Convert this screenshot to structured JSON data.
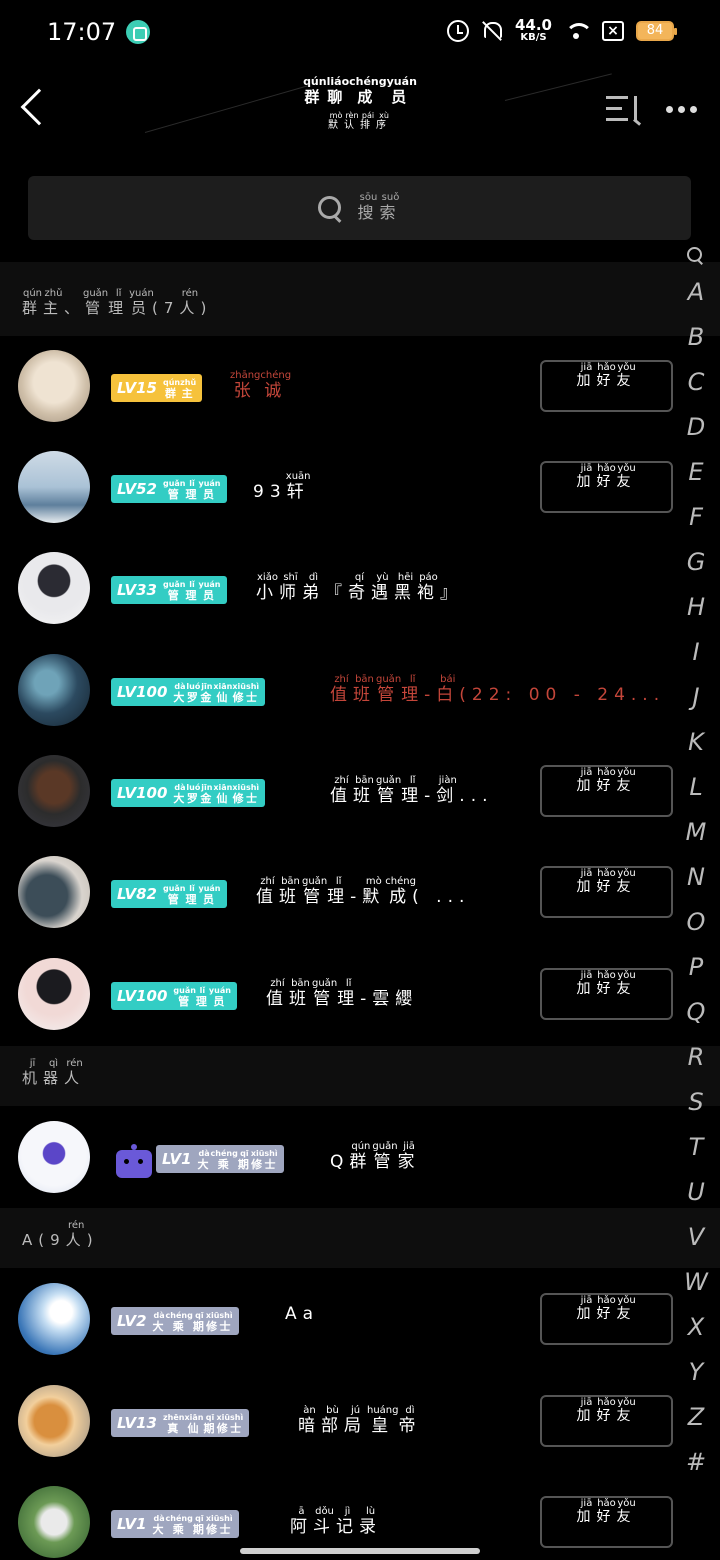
{
  "status_bar": {
    "time": "17:07",
    "net_speed_value": "44.0",
    "net_speed_unit": "KB/S",
    "battery": "84",
    "icons": [
      "app-icon",
      "alarm-icon",
      "mute-icon",
      "wifi-icon",
      "sim-x-icon",
      "battery-icon"
    ]
  },
  "header": {
    "title": [
      [
        "群",
        "qún"
      ],
      [
        "聊",
        "liáo"
      ],
      [
        "成",
        "chéng"
      ],
      [
        "员",
        "yuán"
      ]
    ],
    "subtitle": [
      [
        "默",
        "mò"
      ],
      [
        "认",
        "rèn"
      ],
      [
        "排",
        "pái"
      ],
      [
        "序",
        "xù"
      ]
    ],
    "icons": [
      "back-icon",
      "sort-icon",
      "more-icon"
    ]
  },
  "search": {
    "placeholder": [
      [
        "搜",
        "sōu"
      ],
      [
        "索",
        "suǒ"
      ]
    ]
  },
  "sections": [
    {
      "id": "admins",
      "label": [
        [
          "群",
          "qún"
        ],
        [
          "主",
          "zhǔ"
        ],
        [
          "、",
          ""
        ],
        [
          "管",
          "guǎn"
        ],
        [
          "理",
          "lǐ"
        ],
        [
          "员",
          "yuán"
        ],
        [
          "(7",
          ""
        ],
        [
          "人",
          "rén"
        ],
        [
          ")",
          ""
        ]
      ]
    },
    {
      "id": "robots",
      "label": [
        [
          "机",
          "jī"
        ],
        [
          "器",
          "qì"
        ],
        [
          "人",
          "rén"
        ]
      ]
    },
    {
      "id": "a",
      "label": [
        [
          "A(9",
          ""
        ],
        [
          "人",
          "rén"
        ],
        [
          ")",
          ""
        ]
      ]
    }
  ],
  "add_friend_label": [
    [
      "加",
      "jiā"
    ],
    [
      "好",
      "hǎo"
    ],
    [
      "友",
      "yǒu"
    ]
  ],
  "members": [
    {
      "section": "admins",
      "level": "LV15",
      "badge_type": "owner",
      "title": [
        [
          "群",
          "qún"
        ],
        [
          "主",
          "zhǔ"
        ]
      ],
      "name": [
        [
          "张",
          "zhāng"
        ],
        [
          "诚",
          "chéng"
        ]
      ],
      "name_color": "red",
      "add_button": true
    },
    {
      "section": "admins",
      "level": "LV52",
      "badge_type": "admin",
      "title": [
        [
          "管",
          "guǎn"
        ],
        [
          "理",
          "lǐ"
        ],
        [
          "员",
          "yuán"
        ]
      ],
      "name": [
        [
          "93",
          ""
        ],
        [
          "轩",
          "xuān"
        ]
      ],
      "add_button": true
    },
    {
      "section": "admins",
      "level": "LV33",
      "badge_type": "admin",
      "title": [
        [
          "管",
          "guǎn"
        ],
        [
          "理",
          "lǐ"
        ],
        [
          "员",
          "yuán"
        ]
      ],
      "name": [
        [
          "小",
          "xiǎo"
        ],
        [
          "师",
          "shī"
        ],
        [
          "弟",
          "dì"
        ],
        [
          "『",
          ""
        ],
        [
          "奇",
          "qí"
        ],
        [
          "遇",
          "yù"
        ],
        [
          "黑",
          "hēi"
        ],
        [
          "袍",
          "páo"
        ],
        [
          "』",
          ""
        ]
      ],
      "add_button": false
    },
    {
      "section": "admins",
      "level": "LV100",
      "badge_type": "admin",
      "title": [
        [
          "大",
          "dà"
        ],
        [
          "罗",
          "luó"
        ],
        [
          "金",
          "jīn"
        ],
        [
          "仙",
          "xiān"
        ],
        [
          "修",
          "xiū"
        ],
        [
          "士",
          "shì"
        ]
      ],
      "name": [
        [
          "值",
          "zhí"
        ],
        [
          "班",
          "bān"
        ],
        [
          "管",
          "guǎn"
        ],
        [
          "理",
          "lǐ"
        ],
        [
          "-",
          ""
        ],
        [
          "白",
          "bái"
        ],
        [
          "(22: 00 - 24...",
          ""
        ]
      ],
      "name_color": "red",
      "add_button": false
    },
    {
      "section": "admins",
      "level": "LV100",
      "badge_type": "admin",
      "title": [
        [
          "大",
          "dà"
        ],
        [
          "罗",
          "luó"
        ],
        [
          "金",
          "jīn"
        ],
        [
          "仙",
          "xiān"
        ],
        [
          "修",
          "xiū"
        ],
        [
          "士",
          "shì"
        ]
      ],
      "name": [
        [
          "值",
          "zhí"
        ],
        [
          "班",
          "bān"
        ],
        [
          "管",
          "guǎn"
        ],
        [
          "理",
          "lǐ"
        ],
        [
          "-",
          ""
        ],
        [
          "剑",
          "jiàn"
        ],
        [
          "...",
          ""
        ]
      ],
      "add_button": true
    },
    {
      "section": "admins",
      "level": "LV82",
      "badge_type": "admin",
      "title": [
        [
          "管",
          "guǎn"
        ],
        [
          "理",
          "lǐ"
        ],
        [
          "员",
          "yuán"
        ]
      ],
      "name": [
        [
          "值",
          "zhí"
        ],
        [
          "班",
          "bān"
        ],
        [
          "管",
          "guǎn"
        ],
        [
          "理",
          "lǐ"
        ],
        [
          "-",
          ""
        ],
        [
          "默",
          "mò"
        ],
        [
          "成",
          "chéng"
        ],
        [
          "( ...",
          ""
        ]
      ],
      "add_button": true
    },
    {
      "section": "admins",
      "level": "LV100",
      "badge_type": "admin",
      "title": [
        [
          "管",
          "guǎn"
        ],
        [
          "理",
          "lǐ"
        ],
        [
          "员",
          "yuán"
        ]
      ],
      "name": [
        [
          "值",
          "zhí"
        ],
        [
          "班",
          "bān"
        ],
        [
          "管",
          "guǎn"
        ],
        [
          "理",
          "lǐ"
        ],
        [
          "-雲纓",
          ""
        ]
      ],
      "add_button": true
    },
    {
      "section": "robots",
      "level": "LV1",
      "badge_type": "rank",
      "title": [
        [
          "大",
          "dà"
        ],
        [
          "乘",
          "chéng"
        ],
        [
          "期",
          "qī"
        ],
        [
          "修",
          "xiū"
        ],
        [
          "士",
          "shì"
        ]
      ],
      "name": [
        [
          "Q",
          ""
        ],
        [
          "群",
          "qún"
        ],
        [
          "管",
          "guǎn"
        ],
        [
          "家",
          "jiā"
        ]
      ],
      "add_button": false,
      "robot_icon": true
    },
    {
      "section": "a",
      "level": "LV2",
      "badge_type": "rank",
      "title": [
        [
          "大",
          "dà"
        ],
        [
          "乘",
          "chéng"
        ],
        [
          "期",
          "qī"
        ],
        [
          "修",
          "xiū"
        ],
        [
          "士",
          "shì"
        ]
      ],
      "name": [
        [
          "Aa",
          ""
        ]
      ],
      "add_button": true
    },
    {
      "section": "a",
      "level": "LV13",
      "badge_type": "rank",
      "title": [
        [
          "真",
          "zhēn"
        ],
        [
          "仙",
          "xiān"
        ],
        [
          "期",
          "qī"
        ],
        [
          "修",
          "xiū"
        ],
        [
          "士",
          "shì"
        ]
      ],
      "name": [
        [
          "暗",
          "àn"
        ],
        [
          "部",
          "bù"
        ],
        [
          "局",
          "jú"
        ],
        [
          "皇",
          "huáng"
        ],
        [
          "帝",
          "dì"
        ]
      ],
      "add_button": true
    },
    {
      "section": "a",
      "level": "LV1",
      "badge_type": "rank",
      "title": [
        [
          "大",
          "dà"
        ],
        [
          "乘",
          "chéng"
        ],
        [
          "期",
          "qī"
        ],
        [
          "修",
          "xiū"
        ],
        [
          "士",
          "shì"
        ]
      ],
      "name": [
        [
          "阿",
          "ā"
        ],
        [
          "斗",
          "dǒu"
        ],
        [
          "记",
          "jì"
        ],
        [
          "录",
          "lù"
        ]
      ],
      "add_button": true
    }
  ],
  "index_letters": [
    "A",
    "B",
    "C",
    "D",
    "E",
    "F",
    "G",
    "H",
    "I",
    "J",
    "K",
    "L",
    "M",
    "N",
    "O",
    "P",
    "Q",
    "R",
    "S",
    "T",
    "U",
    "V",
    "W",
    "X",
    "Y",
    "Z",
    "#"
  ],
  "colors": {
    "background": "#000000",
    "owner_badge": "#f6c23c",
    "admin_badge": "#33cdc4",
    "rank_badge": "#9fa6bf",
    "red_name": "#c4463a"
  }
}
